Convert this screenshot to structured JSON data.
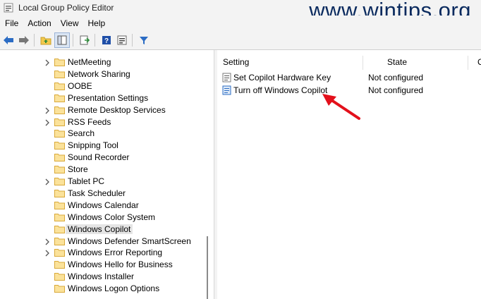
{
  "window": {
    "title": "Local Group Policy Editor",
    "watermark": "www.wintips.org"
  },
  "menu": [
    "File",
    "Action",
    "View",
    "Help"
  ],
  "toolbar": {
    "icons": [
      "back-arrow-icon",
      "forward-arrow-icon",
      "up-folder-icon",
      "show-hide-tree-icon",
      "export-list-icon",
      "help-icon",
      "properties-icon",
      "filter-icon"
    ]
  },
  "tree": {
    "items": [
      {
        "label": "NetMeeting",
        "expandable": true
      },
      {
        "label": "Network Sharing",
        "expandable": false
      },
      {
        "label": "OOBE",
        "expandable": false
      },
      {
        "label": "Presentation Settings",
        "expandable": false
      },
      {
        "label": "Remote Desktop Services",
        "expandable": true
      },
      {
        "label": "RSS Feeds",
        "expandable": true
      },
      {
        "label": "Search",
        "expandable": false
      },
      {
        "label": "Snipping Tool",
        "expandable": false
      },
      {
        "label": "Sound Recorder",
        "expandable": false
      },
      {
        "label": "Store",
        "expandable": false
      },
      {
        "label": "Tablet PC",
        "expandable": true
      },
      {
        "label": "Task Scheduler",
        "expandable": false
      },
      {
        "label": "Windows Calendar",
        "expandable": false
      },
      {
        "label": "Windows Color System",
        "expandable": false
      },
      {
        "label": "Windows Copilot",
        "expandable": false,
        "selected": true
      },
      {
        "label": "Windows Defender SmartScreen",
        "expandable": true
      },
      {
        "label": "Windows Error Reporting",
        "expandable": true
      },
      {
        "label": "Windows Hello for Business",
        "expandable": false
      },
      {
        "label": "Windows Installer",
        "expandable": false
      },
      {
        "label": "Windows Logon Options",
        "expandable": false
      }
    ]
  },
  "list": {
    "columns": {
      "setting": "Setting",
      "state": "State",
      "comment": "C"
    },
    "rows": [
      {
        "setting": "Set Copilot Hardware Key",
        "state": "Not configured"
      },
      {
        "setting": "Turn off Windows Copilot",
        "state": "Not configured",
        "highlighted": true
      }
    ]
  },
  "colors": {
    "accent": "#e3101b",
    "folder": "#f2c94c",
    "selection": "#e0e0e0"
  }
}
